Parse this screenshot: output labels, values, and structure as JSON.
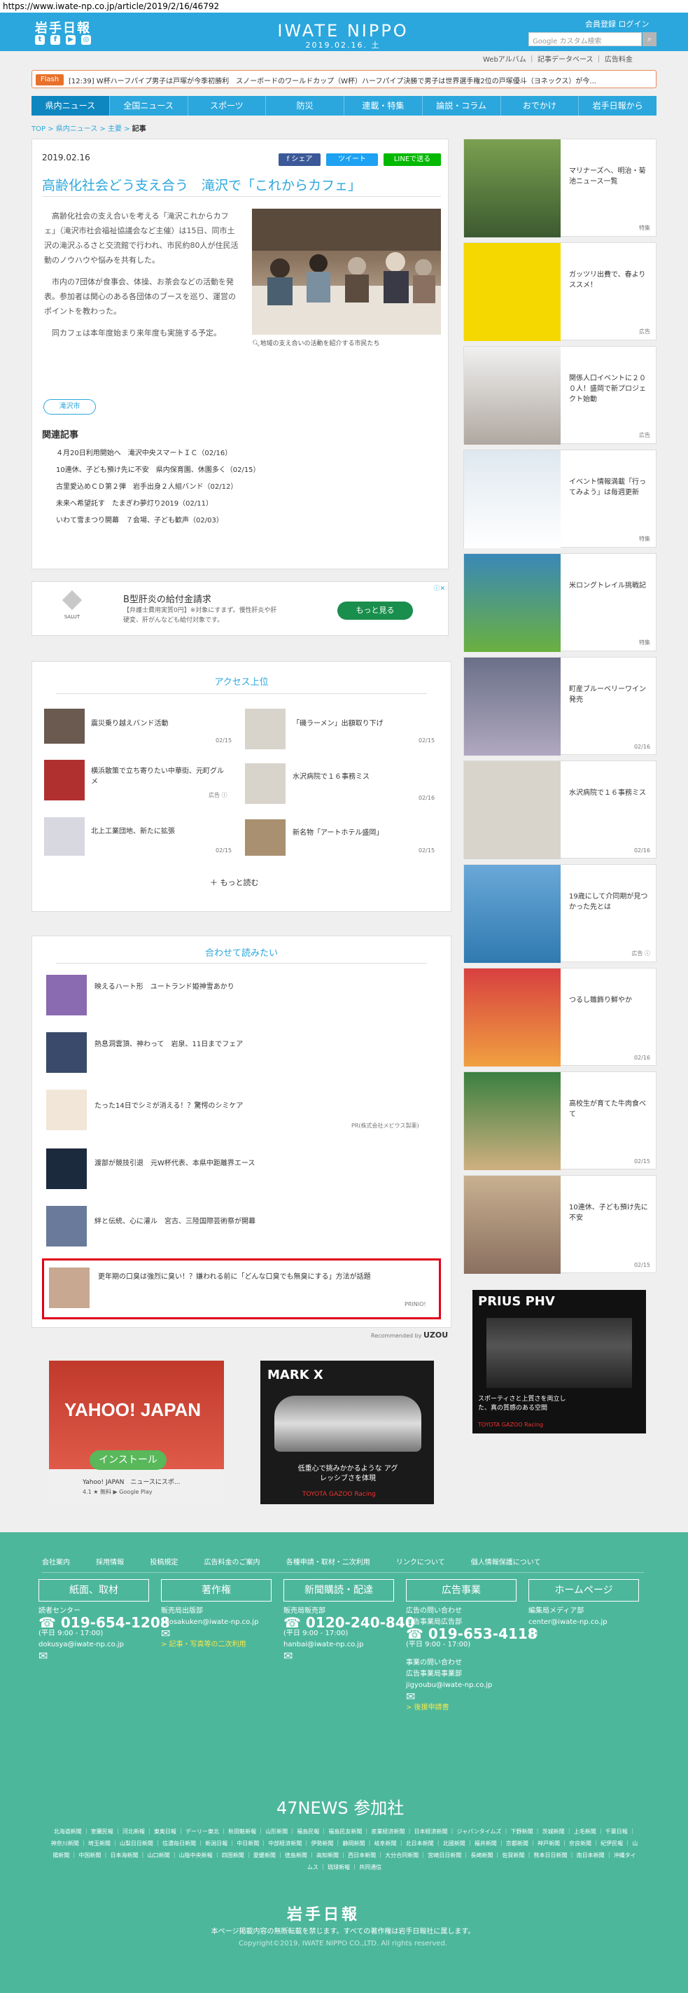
{
  "url": "https://www.iwate-np.co.jp/article/2019/2/16/46792",
  "header": {
    "logo_small": "岩手日報",
    "logo_main": "IWATE NIPPO",
    "date": "2019.02.16. 土",
    "toplinks": "会員登録 ログイン",
    "search_placeholder": "Google カスタム検索",
    "sublinks": "Webアルバム ｜ 記事データベース ｜ 広告料金"
  },
  "flash": {
    "badge": "Flash",
    "text": "[12:39] W杯ハーフパイプ男子は戸塚が今季初勝利　スノーボードのワールドカップ（W杯）ハーフパイプ決勝で男子は世界選手権2位の戸塚優斗（ヨネックス）が今..."
  },
  "nav": [
    "県内ニュース",
    "全国ニュース",
    "スポーツ",
    "防災",
    "連載・特集",
    "論説・コラム",
    "おでかけ",
    "岩手日報から"
  ],
  "breadcrumb": {
    "top": "TOP",
    "cat": "県内ニュース",
    "sub": "主要",
    "cur": "記事"
  },
  "article": {
    "date": "2019.02.16",
    "share_fb": "f シェア",
    "share_tw": "ツイート",
    "share_line": "LINEで送る",
    "title": "高齢化社会どう支え合う　滝沢で「これからカフェ」",
    "p1": "高齢化社会の支え合いを考える「滝沢これからカフェ」（滝沢市社会福祉協議会など主催）は15日、同市土沢の滝沢ふるさと交流館で行われ、市民約80人が住民活動のノウハウや悩みを共有した。",
    "p2": "市内の7団体が食事会、体操、お茶会などの活動を発表。参加者は関心のある各団体のブースを巡り、運営のポイントを教わった。",
    "p3": "同カフェは本年度始まり来年度も実施する予定。",
    "caption": "地域の支え合いの活動を紹介する市民たち",
    "tag": "滝沢市"
  },
  "related": {
    "heading": "関連記事",
    "items": [
      "４月20日利用開始へ　滝沢中央スマートＩＣ（02/16）",
      "10連休、子ども預け先に不安　県内保育園、休園多く（02/15）",
      "古里愛込めＣＤ第２弾　岩手出身２人組バンド（02/12）",
      "未来へ希望託す　たまぎわ夢灯り2019（02/11）",
      "いわて雪まつり開幕　７会場、子ども歓声（02/03）"
    ]
  },
  "ad1": {
    "title": "B型肝炎の給付金請求",
    "desc": "【弁護士費用実質0円】※対象にすまず。慢性肝炎や肝硬変、肝がんなども給付対象です。",
    "button": "もっと見る",
    "brand": "SALUT"
  },
  "access": {
    "heading": "アクセス上位",
    "left": [
      {
        "title": "震災乗り越えバンド活動",
        "date": "02/15"
      },
      {
        "title": "横浜散策で立ち寄りたい中華街、元町グルメ",
        "date": "広告 ⓘ"
      },
      {
        "title": "北上工業団地、新たに拡張",
        "date": "02/15"
      }
    ],
    "right": [
      {
        "title": "「磯ラーメン」出額取り下げ",
        "date": "02/15"
      },
      {
        "title": "水沢病院で１６事務ミス",
        "date": "02/16"
      },
      {
        "title": "新名物「アートホテル盛岡」",
        "date": "02/15"
      }
    ],
    "more": "＋ もっと読む"
  },
  "awase": {
    "heading": "合わせて読みたい",
    "items": [
      "映えるハート形　ユートランド姫神雪あかり",
      "熱息洞雲頂、神わって　岩泉、11日までフェア",
      "たった14日でシミが消える！？驚愕のシミケア",
      "渡部が競技引退　元W杯代表、本県中距離界エース",
      "絆と伝統、心に灌ル　宮古、三陸国際芸術祭が開幕",
      "更年期の口臭は強烈に臭い！？嫌われる前に「どんな口臭でも無臭にする」方法が話題"
    ],
    "pr3": "PR(株式会社メビウス製薬)",
    "pr6": "PRINIO!",
    "powered": "Recommended by"
  },
  "ads_bottom": {
    "yahoo": "YAHOO! JAPAN",
    "install": "インストール",
    "yahoo_sub": "Yahoo! JAPAN　ニュースにスポ...",
    "yahoo_meta": "4.1 ★ 無料  ▶ Google Play",
    "markx": "MARK X",
    "markx_copy": "低重心で挑みかかるような アグレッシブさを体現",
    "markx_brand": "TOYOTA GAZOO Racing",
    "prius": "PRIUS PHV",
    "prius_copy": "スポーティさと上質さを両立した、真の質感のある空間"
  },
  "rail": [
    {
      "title": "マリナーズへ、明治・菊池ニュース一覧",
      "source": "特集"
    },
    {
      "title": "ガッツリ出費で、春よりススメ！",
      "source": "広告"
    },
    {
      "title": "関係人口イベントに２００人！盛岡で新プロジェクト始動",
      "source": "広告"
    },
    {
      "title": "イベント情報満載「行ってみよう」は毎週更新",
      "source": "特集"
    },
    {
      "title": "米ロングトレイル挑戦記",
      "source": "特集"
    },
    {
      "title": "町産ブルーベリーワイン発売",
      "source": "02/16"
    },
    {
      "title": "水沢病院で１６事務ミス",
      "source": "02/16"
    },
    {
      "title": "19歳にして介同期が見つかった先とは",
      "source": "広告 ⓘ"
    },
    {
      "title": "つるし雛飾り鮮やか",
      "source": "02/16"
    },
    {
      "title": "高校生が育てた牛肉食べて",
      "source": "02/15"
    },
    {
      "title": "10連休、子ども預け先に不安",
      "source": "02/15"
    }
  ],
  "footer": {
    "links": "会社案内 採用情報 投稿規定 広告料金のご案内 各種申請・取材・二次利用 リンクについて 個人情報保護について",
    "cats": [
      "紙面、取材",
      "著作権",
      "新聞購読・配達",
      "広告事業",
      "ホームページ"
    ],
    "c1_label": "読者センター",
    "c1_phone": "019-654-1208",
    "c1_hours": "(平日 9:00 - 17:00)",
    "c1_mail": "dokusya@iwate-np.co.jp",
    "c2_label": "販売局出版部",
    "c2_mail": "chosakuken@iwate-np.co.jp",
    "c2_link": "> 記事・写真等の二次利用",
    "c3_label": "販売局販売部",
    "c3_phone": "0120-240-840",
    "c3_hours": "(平日 9:00 - 17:00)",
    "c3_mail": "hanbai@iwate-np.co.jp",
    "c4_label1": "広告の問い合わせ",
    "c4_label2": "広告事業局広告部",
    "c4_phone": "019-653-4118",
    "c4_hours": "(平日 9:00 - 17:00)",
    "c4_label3": "事業の問い合わせ",
    "c4_label4": "広告事業局事業部",
    "c4_mail": "jigyoubu@iwate-np.co.jp",
    "c4_link": "> 後援申請書",
    "c5_label": "編集局メディア部",
    "c5_mail": "center@iwate-np.co.jp",
    "n47": "47NEWS 参加社",
    "papers": "北海道新聞 ｜ 室蘭民報 ｜ 河北新報 ｜ 東奥日報 ｜ デーリー東北 ｜ 秋田魁新報 ｜ 山形新聞 ｜ 福島民報 ｜ 福島民友新聞 ｜ 産業経済新聞 ｜ 日本経済新聞 ｜ ジャパンタイムズ ｜ 下野新聞 ｜ 茨城新聞 ｜ 上毛新聞 ｜ 千葉日報 ｜ 神奈川新聞 ｜ 埼玉新聞 ｜ 山梨日日新聞 ｜ 信濃毎日新聞 ｜ 新潟日報 ｜ 中日新聞 ｜ 中部経済新聞 ｜ 伊勢新聞 ｜ 静岡新聞 ｜ 岐阜新聞 ｜ 北日本新聞 ｜ 北國新聞 ｜ 福井新聞 ｜ 京都新聞 ｜ 神戸新聞 ｜ 奈良新聞 ｜ 紀伊民報 ｜ 山陽新聞 ｜ 中国新聞 ｜ 日本海新聞 ｜ 山口新聞 ｜ 山陰中央新報 ｜ 四国新聞 ｜ 愛媛新聞 ｜ 徳島新聞 ｜ 高知新聞 ｜ 西日本新聞 ｜ 大分合同新聞 ｜ 宮崎日日新聞 ｜ 長崎新聞 ｜ 佐賀新聞 ｜ 熊本日日新聞 ｜ 南日本新聞 ｜ 沖縄タイムス ｜ 琉球新報 ｜ 共同通信",
    "logo": "岩手日報",
    "copy1": "本ページ掲載内容の無断転載を禁じます。すべての著作権は岩手日報社に属します。",
    "copy2": "Copyright©2019, IWATE NIPPO CO.,LTD. All rights reserved."
  }
}
